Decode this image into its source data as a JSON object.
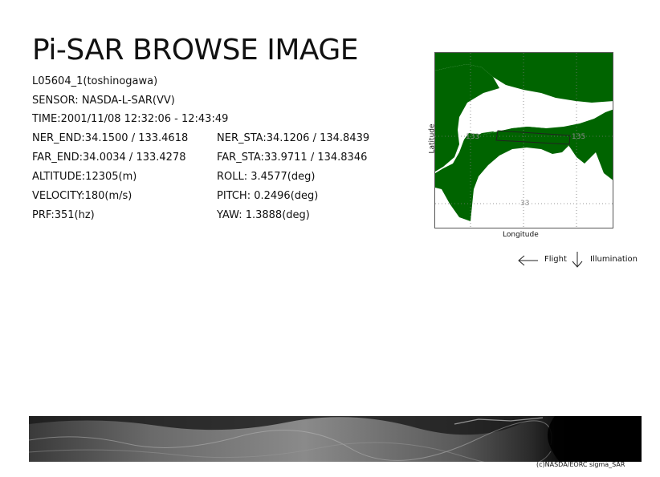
{
  "title": "Pi-SAR BROWSE IMAGE",
  "info": {
    "id": "L05604_1(toshinogawa)",
    "sensor": "SENSOR: NASDA-L-SAR(VV)",
    "time": "TIME:2001/11/08  12:32:06 - 12:43:49",
    "ner_end": "NER_END:34.1500 / 133.4618",
    "ner_sta": "NER_STA:34.1206 / 134.8439",
    "far_end": "FAR_END:34.0034 / 133.4278",
    "far_sta": "FAR_STA:33.9711 / 134.8346",
    "altitude": "ALTITUDE:12305(m)",
    "roll": "ROLL: 3.4577(deg)",
    "velocity": "VELOCITY:180(m/s)",
    "pitch": "PITCH: 0.2496(deg)",
    "prf": "PRF:351(hz)",
    "yaw": "YAW:  1.3888(deg)"
  },
  "map": {
    "xlabel": "Longitude",
    "ylabel": "Latitude",
    "grid_labels": {
      "lon_left": "133",
      "lon_right": "135",
      "lat": "33"
    },
    "land_color": "#006400"
  },
  "legend": {
    "flight": "Flight",
    "illumination": "Illumination"
  },
  "copyright": "(c)NASDA/EORC sigma_SAR"
}
